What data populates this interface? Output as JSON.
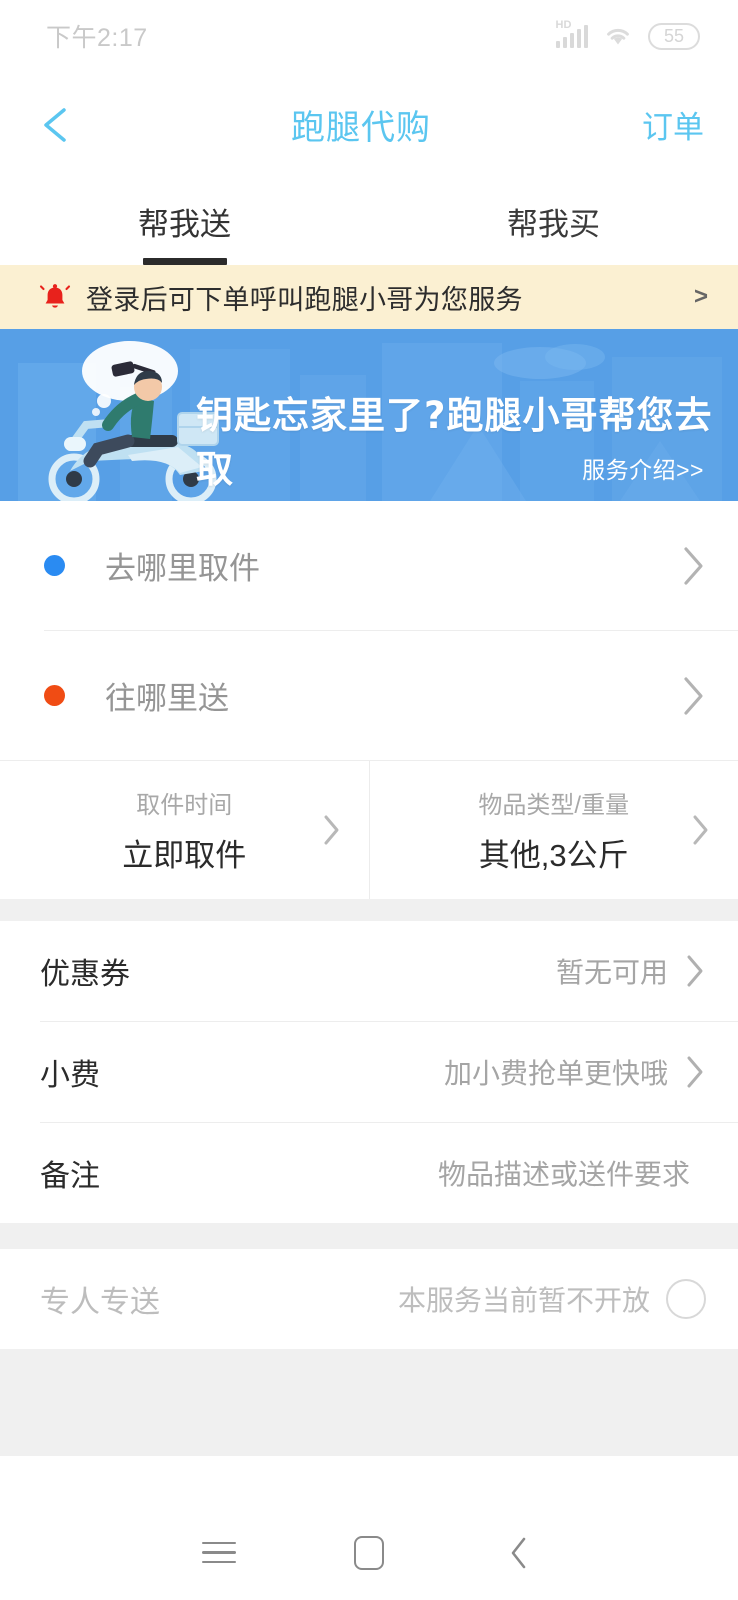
{
  "status_bar": {
    "time": "下午2:17",
    "network_label": "HD",
    "battery_level": "55",
    "icons": [
      "signal-icon",
      "wifi-icon",
      "battery-icon"
    ]
  },
  "header": {
    "back_icon": "chevron-left-icon",
    "title": "跑腿代购",
    "action_label": "订单",
    "title_color": "#5BC6F0"
  },
  "tabs": [
    {
      "label": "帮我送",
      "active": true
    },
    {
      "label": "帮我买",
      "active": false
    }
  ],
  "notice": {
    "icon": "bell-icon",
    "text": "登录后可下单呼叫跑腿小哥为您服务",
    "arrow": ">",
    "background": "#FBF0D2",
    "icon_color": "#E8221C"
  },
  "banner": {
    "title": "钥匙忘家里了?跑腿小哥帮您去取",
    "link_label": "服务介绍>>",
    "background": "#579FE6",
    "illustration": "scooter-courier-illustration"
  },
  "address": {
    "pickup": {
      "label": "去哪里取件",
      "dot_color": "#2A8BF2"
    },
    "dropoff": {
      "label": "往哪里送",
      "dot_color": "#F04C14"
    }
  },
  "details": [
    {
      "label": "取件时间",
      "value": "立即取件"
    },
    {
      "label": "物品类型/重量",
      "value": "其他,3公斤"
    }
  ],
  "options": [
    {
      "label": "优惠券",
      "value": "暂无可用",
      "has_chevron": true,
      "disabled": false
    },
    {
      "label": "小费",
      "value": "加小费抢单更快哦",
      "has_chevron": true,
      "disabled": false
    },
    {
      "label": "备注",
      "value": "物品描述或送件要求",
      "has_chevron": false,
      "disabled": false
    }
  ],
  "special": {
    "label": "专人专送",
    "value": "本服务当前暂不开放",
    "control": "radio-circle",
    "checked": false,
    "disabled": true
  },
  "nav_bar": {
    "recents": "recents-icon",
    "home": "home-icon",
    "back": "back-icon"
  }
}
